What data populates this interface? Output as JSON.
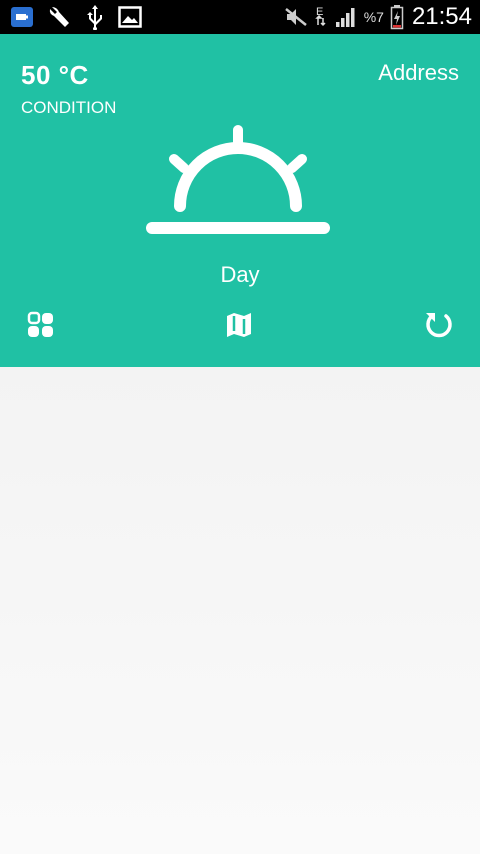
{
  "status_bar": {
    "icons_left": [
      "battery-saver-icon",
      "wrench-icon",
      "usb-icon",
      "image-icon"
    ],
    "icons_right": [
      "mute-icon",
      "data-edge-icon",
      "signal-icon"
    ],
    "battery_text": "%7",
    "time": "21:54"
  },
  "weather": {
    "temperature": "50 °C",
    "condition": "CONDITION",
    "address": "Address",
    "period": "Day",
    "icon": "sunrise-icon"
  },
  "toolbar": {
    "items": [
      "grid-icon",
      "map-icon",
      "refresh-icon"
    ]
  },
  "colors": {
    "accent": "#20c1a4",
    "background": "#f5f5f5",
    "status_bar": "#000000"
  }
}
